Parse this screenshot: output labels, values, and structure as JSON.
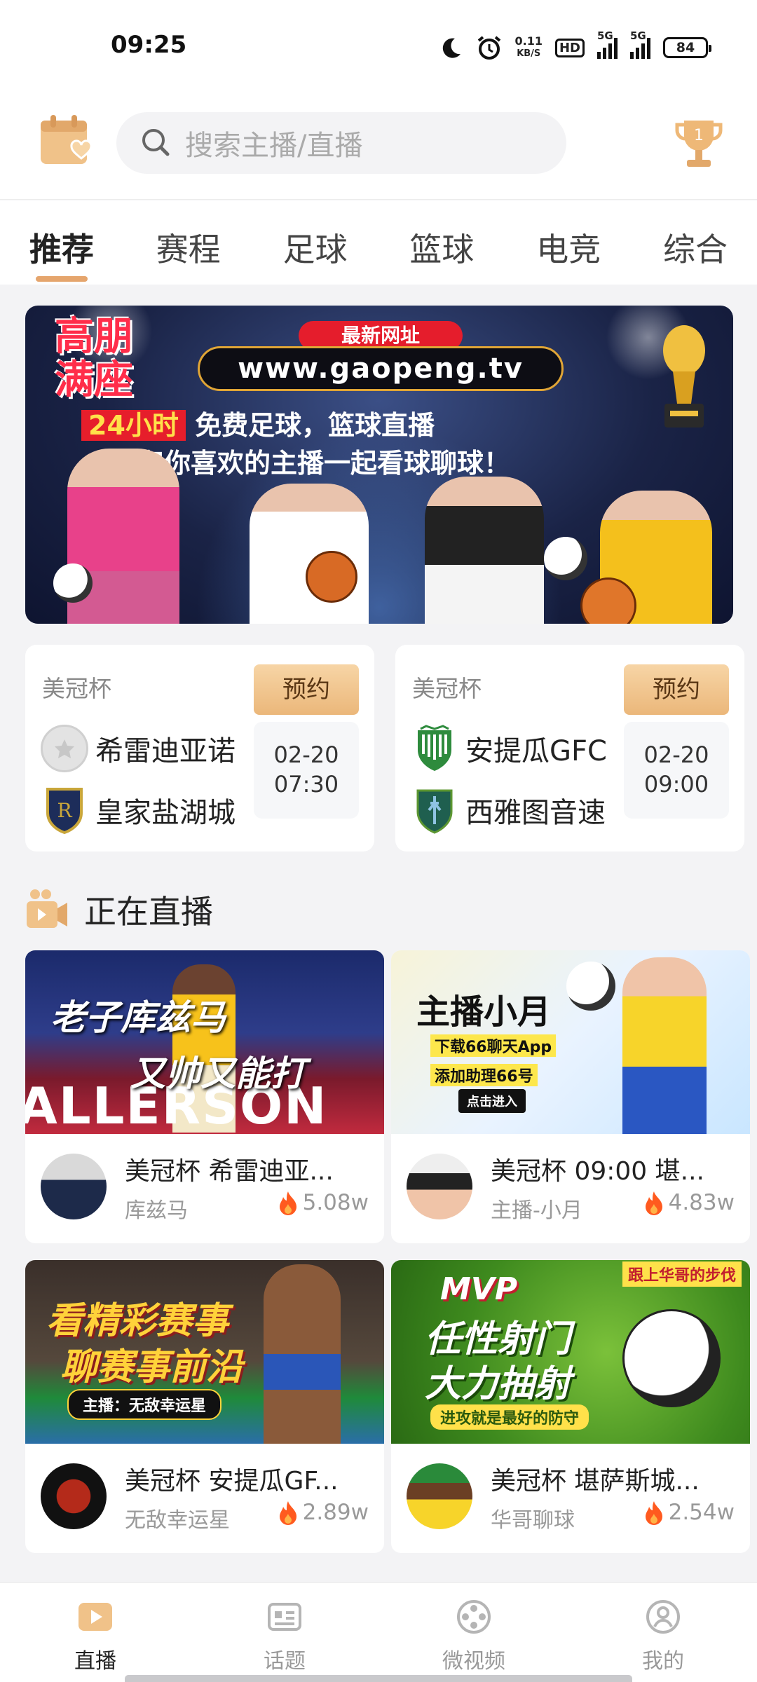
{
  "status_bar": {
    "time": "09:25",
    "net_speed_value": "0.11",
    "net_speed_unit": "KB/S",
    "hd_label": "HD",
    "sim1": "5G",
    "sim2": "5G",
    "battery": "84"
  },
  "header": {
    "search_placeholder": "搜索主播/直播"
  },
  "tabs": [
    {
      "label": "推荐",
      "active": true
    },
    {
      "label": "赛程",
      "active": false
    },
    {
      "label": "足球",
      "active": false
    },
    {
      "label": "篮球",
      "active": false
    },
    {
      "label": "电竞",
      "active": false
    },
    {
      "label": "综合",
      "active": false
    }
  ],
  "banner": {
    "brand": "高朋满座",
    "url_tag": "最新网址",
    "url": "www.gaopeng.tv",
    "line1_highlight": "24小时",
    "line1_rest": "免费足球，篮球直播",
    "line2": "和你喜欢的主播一起看球聊球！"
  },
  "matches": [
    {
      "league": "美冠杯",
      "book_label": "预约",
      "home": "希雷迪亚诺",
      "away": "皇家盐湖城",
      "date": "02-20",
      "time": "07:30"
    },
    {
      "league": "美冠杯",
      "book_label": "预约",
      "home": "安提瓜GFC",
      "away": "西雅图音速",
      "date": "02-20",
      "time": "09:00"
    }
  ],
  "live_section": {
    "title": "正在直播"
  },
  "live_cards": [
    {
      "title": "美冠杯 希雷迪亚...",
      "host": "库兹马",
      "heat": "5.08w",
      "thumb_line1": "老子库兹马",
      "thumb_line2": "又帅又能打",
      "thumb_sign": "ALLERSON"
    },
    {
      "title": "美冠杯  09:00 堪...",
      "host": "主播-小月",
      "heat": "4.83w",
      "thumb_line1": "主播小月",
      "thumb_line2": "下载66聊天App",
      "thumb_line3": "添加助理66号",
      "thumb_btn": "点击进入"
    },
    {
      "title": "美冠杯 安提瓜GF...",
      "host": "无敌幸运星",
      "heat": "2.89w",
      "thumb_line1": "看精彩赛事",
      "thumb_line2": "聊赛事前沿",
      "thumb_line3": "主播：无敌幸运星"
    },
    {
      "title": "美冠杯 堪萨斯城...",
      "host": "华哥聊球",
      "heat": "2.54w",
      "thumb_line1": "任性射门",
      "thumb_line2": "大力抽射",
      "thumb_line3": "进攻就是最好的防守",
      "thumb_tag": "跟上华哥的步伐",
      "thumb_mvp": "MVP"
    }
  ],
  "bottom_nav": [
    {
      "label": "直播",
      "icon": "play-icon",
      "active": true
    },
    {
      "label": "话题",
      "icon": "topic-icon",
      "active": false
    },
    {
      "label": "微视频",
      "icon": "film-reel-icon",
      "active": false
    },
    {
      "label": "我的",
      "icon": "profile-icon",
      "active": false
    }
  ],
  "colors": {
    "accent": "#e5a56d",
    "book_button": "#ebb77a",
    "heat_flame": "#ff5a1f"
  }
}
